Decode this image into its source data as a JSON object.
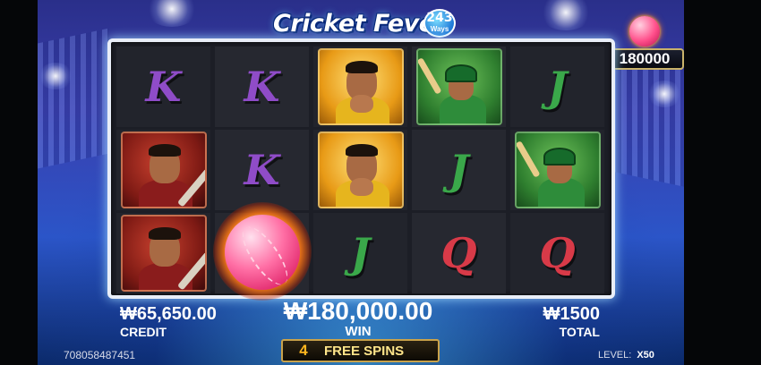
{
  "logo": {
    "title": "Cricket Fever",
    "ways_number": "243",
    "ways_label": "Ways"
  },
  "jackpot": {
    "value": "180000"
  },
  "reels": [
    [
      "K",
      "player-red",
      "player-red"
    ],
    [
      "K",
      "K",
      "fire-ball"
    ],
    [
      "player-gold",
      "player-gold",
      "J"
    ],
    [
      "batsman-green",
      "J",
      "Q"
    ],
    [
      "J",
      "batsman-green",
      "Q"
    ]
  ],
  "hud": {
    "credit_value": "₩65,650.00",
    "credit_label": "CREDIT",
    "win_value": "₩180,000.00",
    "win_label": "WIN",
    "total_value": "₩1500",
    "total_label": "TOTAL"
  },
  "free_spins": {
    "count": "4",
    "label": "FREE SPINS"
  },
  "footer": {
    "game_id": "708058487451",
    "level_label": "LEVEL:",
    "level_value": "X50"
  },
  "colors": {
    "k": "#8f4cc8",
    "j": "#3aa84a",
    "q": "#d83a48",
    "frame": "#e9eef8",
    "free_spins_accent": "#ffb61f"
  }
}
